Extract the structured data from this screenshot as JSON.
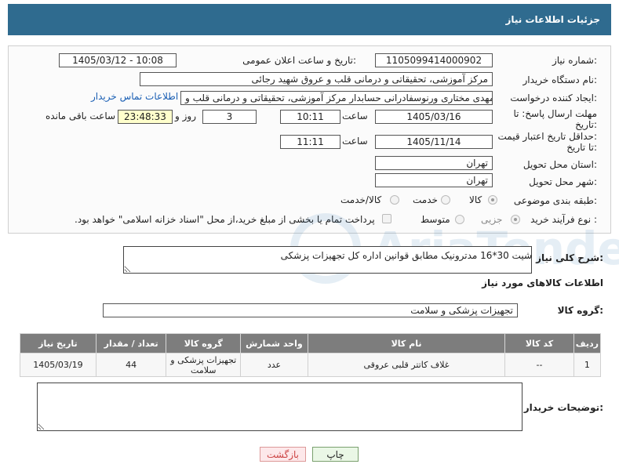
{
  "header": {
    "title": "جزئیات اطلاعات نیاز"
  },
  "need_number": {
    "label": "شماره نیاز:",
    "value": "1105099414000902"
  },
  "announce_datetime": {
    "label": "تاریخ و ساعت اعلان عمومی:",
    "value": "1405/03/12 - 10:08"
  },
  "buyer_org": {
    "label": "نام دستگاه خریدار:",
    "value": "مرکز آموزشی، تحقیقاتی و درمانی قلب و عروق شهید رجائی"
  },
  "requester": {
    "label": "ایجاد کننده درخواست:",
    "value": "مهدی مختاری ورنوسفادرانی حسابدار مرکز آموزشی، تحقیقاتی و درمانی قلب و",
    "contact_link": "اطلاعات تماس خریدار"
  },
  "reply_deadline": {
    "label_line1": "مهلت ارسال پاسخ: تا",
    "label_line2": "تاریخ:",
    "date": "1405/03/16",
    "time_label": "ساعت",
    "time": "10:11",
    "days": "3",
    "days_label": "روز و",
    "remaining": "23:48:33",
    "remaining_label": "ساعت باقی مانده"
  },
  "price_validity": {
    "label_line1": "حداقل تاریخ اعتبار قیمت:",
    "label_line2": "تا تاریخ:",
    "date": "1405/11/14",
    "time_label": "ساعت",
    "time": "11:11"
  },
  "province": {
    "label": "استان محل تحویل:",
    "value": "تهران"
  },
  "city": {
    "label": "شهر محل تحویل:",
    "value": "تهران"
  },
  "category": {
    "label": "طبقه بندی موضوعی:",
    "options": [
      "کالا",
      "خدمت",
      "کالا/خدمت"
    ],
    "selected": "کالا"
  },
  "purchase_type": {
    "label": "نوع فرآیند خرید :",
    "options": [
      "جزیی",
      "متوسط"
    ],
    "payment_note": "پرداخت تمام یا بخشی از مبلغ خرید،از محل \"اسناد خزانه اسلامی\" خواهد بود."
  },
  "general_desc": {
    "label": "شرح کلی نیاز:",
    "value": "شیت 30*16 مدترونیک مطابق قوانین اداره کل تجهیزات پزشکی"
  },
  "goods_info": {
    "title": "اطلاعات کالاهای مورد نیاز"
  },
  "goods_group": {
    "label": "گروه کالا:",
    "value": "تجهیزات پزشکی و سلامت"
  },
  "table": {
    "headers": [
      "ردیف",
      "کد کالا",
      "نام کالا",
      "واحد شمارش",
      "گروه کالا",
      "تعداد / مقدار",
      "تاریخ نیاز"
    ],
    "rows": [
      [
        "1",
        "--",
        "غلاف کاتتر قلبی عروقی",
        "عدد",
        "تجهیزات پزشکی و سلامت",
        "44",
        "1405/03/19"
      ]
    ]
  },
  "buyer_notes": {
    "label": "توضیحات خریدار:",
    "value": ""
  },
  "buttons": {
    "print": "چاپ",
    "back": "بازگشت"
  },
  "watermark": {
    "text": "AriaTender.net",
    "color": "#3d7fb8"
  },
  "colors": {
    "header": "#2f6b8f",
    "table_header": "#7d7d7d",
    "link": "#1a5fb4"
  }
}
